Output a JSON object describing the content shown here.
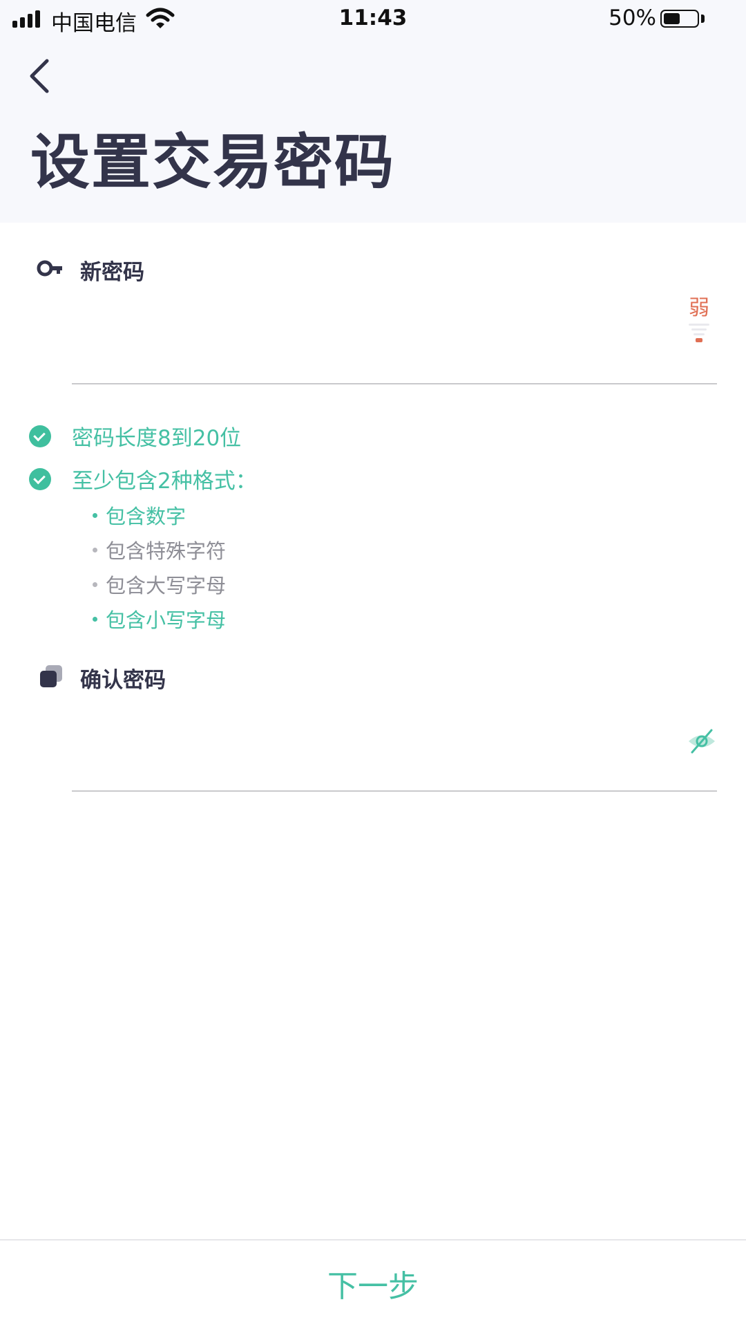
{
  "status_bar": {
    "carrier": "中国电信",
    "time": "11:43",
    "battery_percent": "50%",
    "battery_level": 0.5,
    "signal_icon": "signal-bars-icon",
    "wifi_icon": "wifi-icon"
  },
  "header": {
    "back_icon": "chevron-left-icon",
    "title": "设置交易密码"
  },
  "new_password": {
    "icon": "key-icon",
    "label": "新密码",
    "value": "",
    "strength_label": "弱",
    "strength_level": "weak"
  },
  "rules": [
    {
      "text": "密码长度8到20位",
      "met": true
    },
    {
      "text": "至少包含2种格式：",
      "met": true
    }
  ],
  "formats": [
    {
      "text": "包含数字",
      "met": true
    },
    {
      "text": "包含特殊字符",
      "met": false
    },
    {
      "text": "包含大写字母",
      "met": false
    },
    {
      "text": "包含小写字母",
      "met": true
    }
  ],
  "confirm_password": {
    "icon": "stacked-squares-icon",
    "label": "确认密码",
    "value": "",
    "visibility_icon": "eye-off-icon"
  },
  "footer": {
    "next_label": "下一步"
  },
  "colors": {
    "accent": "#45c0a4",
    "weak": "#e06f54",
    "title": "#33344a",
    "header_bg": "#f7f8fc"
  }
}
